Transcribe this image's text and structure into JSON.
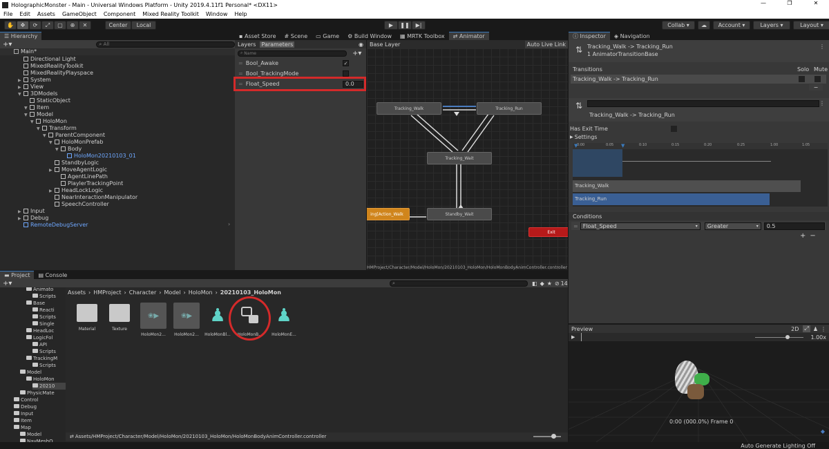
{
  "window": {
    "title": "HolographicMonster - Main - Universal Windows Platform - Unity 2019.4.11f1 Personal* <DX11>",
    "controls": [
      "—",
      "❐",
      "✕"
    ]
  },
  "menu": [
    "File",
    "Edit",
    "Assets",
    "GameObject",
    "Component",
    "Mixed Reality Toolkit",
    "Window",
    "Help"
  ],
  "toolbar": {
    "pivot": "Center",
    "space": "Local",
    "collab": "Collab",
    "account": "Account",
    "layers": "Layers",
    "layout": "Layout"
  },
  "hierarchy": {
    "tab": "Hierarchy",
    "search_placeholder": "All",
    "scene": "Main*",
    "items": [
      {
        "label": "Directional Light",
        "depth": 1
      },
      {
        "label": "MixedRealityToolkit",
        "depth": 1
      },
      {
        "label": "MixedRealityPlayspace",
        "depth": 1
      },
      {
        "label": "System",
        "depth": 1
      },
      {
        "label": "View",
        "depth": 1
      },
      {
        "label": "3DModels",
        "depth": 1
      },
      {
        "label": "StaticObject",
        "depth": 2
      },
      {
        "label": "Item",
        "depth": 2
      },
      {
        "label": "Model",
        "depth": 2
      },
      {
        "label": "HoloMon",
        "depth": 3
      },
      {
        "label": "Transform",
        "depth": 4
      },
      {
        "label": "ParentComponent",
        "depth": 5
      },
      {
        "label": "HoloMonPrefab",
        "depth": 6
      },
      {
        "label": "Body",
        "depth": 7
      },
      {
        "label": "HoloMon20210103_01",
        "depth": 8
      },
      {
        "label": "StandbyLogic",
        "depth": 6
      },
      {
        "label": "MoveAgentLogic",
        "depth": 6
      },
      {
        "label": "AgentLinePath",
        "depth": 7
      },
      {
        "label": "PlaylerTrackingPoint",
        "depth": 7
      },
      {
        "label": "HeadLockLogic",
        "depth": 6
      },
      {
        "label": "NearInteractionManipulator",
        "depth": 6
      },
      {
        "label": "SpeechController",
        "depth": 6
      },
      {
        "label": "Input",
        "depth": 1
      },
      {
        "label": "Debug",
        "depth": 1
      },
      {
        "label": "RemoteDebugServer",
        "depth": 1
      }
    ]
  },
  "center_tabs": [
    "Asset Store",
    "Scene",
    "Game",
    "Build Window",
    "MRTK Toolbox",
    "Animator"
  ],
  "animator": {
    "subtabs": [
      "Layers",
      "Parameters"
    ],
    "name_placeholder": "Name",
    "layer": "Base Layer",
    "auto_live_link": "Auto Live Link",
    "parameters": [
      {
        "name": "Bool_Awake",
        "value": "✓"
      },
      {
        "name": "Bool_TrackingMode",
        "value": ""
      },
      {
        "name": "Float_Speed",
        "value": "0.0"
      }
    ],
    "states": {
      "walk": "Tracking_Walk",
      "run": "Tracking_Run",
      "wait": "Tracking_Wait",
      "standby": "Standby_Wait",
      "action": "ing[Action_Walk",
      "exit": "Exit"
    },
    "path": "HMProject/Character/Model/HoloMon/20210103_HoloMon/HoloMonBodyAnimController.controller"
  },
  "project": {
    "tabs": [
      "Project",
      "Console"
    ],
    "breadcrumb": [
      "Assets",
      "HMProject",
      "Character",
      "Model",
      "HoloMon",
      "20210103_HoloMon"
    ],
    "badge": "14",
    "tree": [
      {
        "label": "Animato",
        "depth": 2
      },
      {
        "label": "Scripts",
        "depth": 3
      },
      {
        "label": "Base",
        "depth": 2
      },
      {
        "label": "Reacti",
        "depth": 3
      },
      {
        "label": "Scripts",
        "depth": 3
      },
      {
        "label": "Single",
        "depth": 3
      },
      {
        "label": "HeadLoc",
        "depth": 2
      },
      {
        "label": "LogicFol",
        "depth": 2
      },
      {
        "label": "API",
        "depth": 3
      },
      {
        "label": "Scripts",
        "depth": 3
      },
      {
        "label": "TrackingM",
        "depth": 2
      },
      {
        "label": "Scripts",
        "depth": 3
      },
      {
        "label": "Model",
        "depth": 1
      },
      {
        "label": "HoloMon",
        "depth": 2
      },
      {
        "label": "20210",
        "depth": 3
      },
      {
        "label": "PhysicMate",
        "depth": 1
      },
      {
        "label": "Control",
        "depth": 0
      },
      {
        "label": "Debug",
        "depth": 0
      },
      {
        "label": "Input",
        "depth": 0
      },
      {
        "label": "Item",
        "depth": 0
      },
      {
        "label": "Map",
        "depth": 0
      },
      {
        "label": "Model",
        "depth": 1
      },
      {
        "label": "NavMeshO",
        "depth": 1
      }
    ],
    "assets": [
      "Material",
      "Texture",
      "HoloMon2...",
      "HoloMon2...",
      "HoloMonBl...",
      "HoloMonB...",
      "HoloMonE..."
    ],
    "footer_path": "Assets/HMProject/Character/Model/HoloMon/20210103_HoloMon/HoloMonBodyAnimController.controller"
  },
  "inspector": {
    "tabs": [
      "Inspector",
      "Navigation"
    ],
    "title": "Tracking_Walk -> Tracking_Run",
    "subtitle": "1 AnimatorTransitionBase",
    "transitions_label": "Transitions",
    "solo": "Solo",
    "mute": "Mute",
    "transition_row": "Tracking_Walk -> Tracking_Run",
    "transition_name": "Tracking_Walk -> Tracking_Run",
    "has_exit_time": "Has Exit Time",
    "settings": "Settings",
    "timeline_ticks": [
      "0:00",
      "0:05",
      "0:10",
      "0:15",
      "0:20",
      "0:25",
      "1:00",
      "1:05"
    ],
    "track_walk": "Tracking_Walk",
    "track_run": "Tracking_Run",
    "conditions": "Conditions",
    "cond_param": "Float_Speed",
    "cond_op": "Greater",
    "cond_value": "0.5",
    "preview": "Preview",
    "preview_2d": "2D",
    "preview_speed": "1.00x",
    "preview_frame": "0:00 (000.0%) Frame 0"
  },
  "status": "Auto Generate Lighting Off",
  "colors": {
    "accent": "#3a79bb",
    "highlight": "#d42a2a",
    "state": "#4a4a4a",
    "entry": "#d0851c",
    "exit": "#b71a1a"
  }
}
